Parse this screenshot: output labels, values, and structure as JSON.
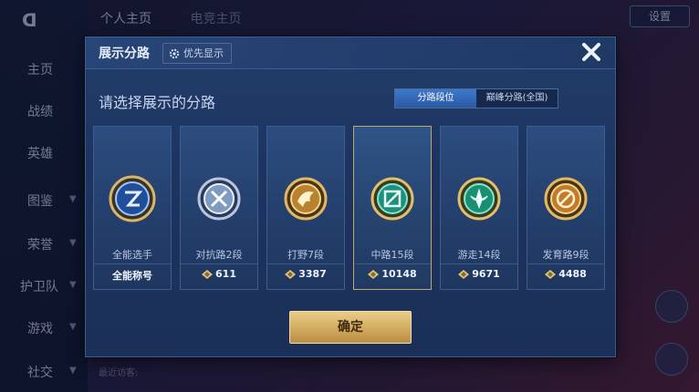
{
  "background": {
    "tabs": [
      "个人主页",
      "电竞主页"
    ],
    "sidebar": [
      "主页",
      "战绩",
      "英雄",
      "图鉴",
      "荣誉",
      "护卫队",
      "游戏",
      "社交"
    ],
    "settings_label": "设置",
    "footer_text": "最近访客:"
  },
  "dialog": {
    "title": "展示分路",
    "priority_label": "优先显示",
    "subtitle": "请选择展示的分路",
    "segments": [
      {
        "label": "分路段位",
        "active": true
      },
      {
        "label": "巅峰分路(全国)",
        "active": false
      }
    ],
    "cards": [
      {
        "name": "全能选手",
        "bottom": "全能称号",
        "emblem": "all-round-emblem-icon",
        "selected": false
      },
      {
        "name": "对抗路2段",
        "points": "611",
        "emblem": "clash-lane-emblem-icon",
        "selected": false
      },
      {
        "name": "打野7段",
        "points": "3387",
        "emblem": "jungle-emblem-icon",
        "selected": false
      },
      {
        "name": "中路15段",
        "points": "10148",
        "emblem": "mid-lane-emblem-icon",
        "selected": true
      },
      {
        "name": "游走14段",
        "points": "9671",
        "emblem": "roam-emblem-icon",
        "selected": false
      },
      {
        "name": "发育路9段",
        "points": "4488",
        "emblem": "farm-lane-emblem-icon",
        "selected": false
      }
    ],
    "confirm_label": "确定"
  },
  "colors": {
    "gold": "#d4ad62",
    "panel": "#1d3460",
    "active_segment": "#2b5aa4"
  }
}
